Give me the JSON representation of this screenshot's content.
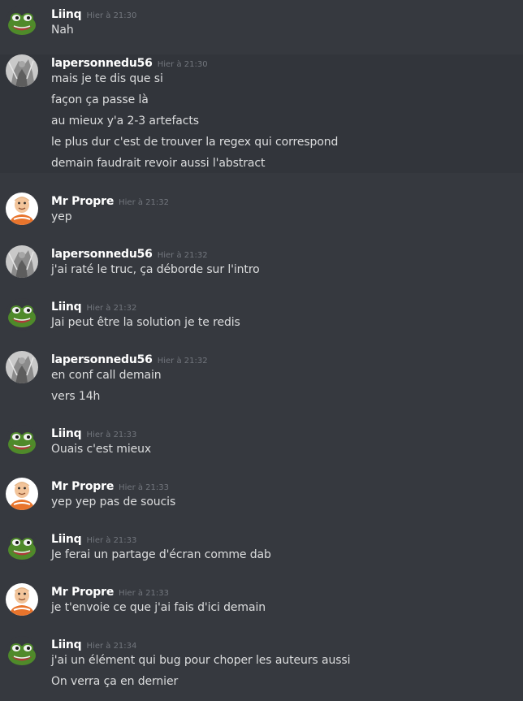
{
  "messages": [
    {
      "author": "Liinq",
      "avatar": "frog-avatar",
      "time": "Hier à 21:30",
      "lines": [
        "Nah"
      ]
    },
    {
      "author": "lapersonnedu56",
      "avatar": "photo-avatar",
      "time": "Hier à 21:30",
      "lines": [
        "mais je te dis que si",
        "façon ça passe là",
        "au mieux y'a 2-3 artefacts",
        "le plus dur c'est de trouver la regex qui correspond",
        "demain faudrait revoir aussi l'abstract"
      ]
    },
    {
      "author": "Mr Propre",
      "avatar": "cartoon-avatar",
      "time": "Hier à 21:32",
      "lines": [
        "yep"
      ]
    },
    {
      "author": "lapersonnedu56",
      "avatar": "photo-avatar",
      "time": "Hier à 21:32",
      "lines": [
        "j'ai raté le truc, ça déborde sur l'intro"
      ]
    },
    {
      "author": "Liinq",
      "avatar": "frog-avatar",
      "time": "Hier à 21:32",
      "lines": [
        "Jai peut être la solution je te redis"
      ]
    },
    {
      "author": "lapersonnedu56",
      "avatar": "photo-avatar",
      "time": "Hier à 21:32",
      "lines": [
        "en conf call demain",
        "vers 14h"
      ]
    },
    {
      "author": "Liinq",
      "avatar": "frog-avatar",
      "time": "Hier à 21:33",
      "lines": [
        "Ouais c'est mieux"
      ]
    },
    {
      "author": "Mr Propre",
      "avatar": "cartoon-avatar",
      "time": "Hier à 21:33",
      "lines": [
        "yep yep pas de soucis"
      ]
    },
    {
      "author": "Liinq",
      "avatar": "frog-avatar",
      "time": "Hier à 21:33",
      "lines": [
        "Je ferai un partage d'écran comme dab"
      ]
    },
    {
      "author": "Mr Propre",
      "avatar": "cartoon-avatar",
      "time": "Hier à 21:33",
      "lines": [
        "je t'envoie ce que j'ai fais d'ici demain"
      ]
    },
    {
      "author": "Liinq",
      "avatar": "frog-avatar",
      "time": "Hier à 21:34",
      "lines": [
        "j'ai un élément qui bug pour choper les auteurs aussi",
        "On verra ça en dernier"
      ]
    }
  ]
}
